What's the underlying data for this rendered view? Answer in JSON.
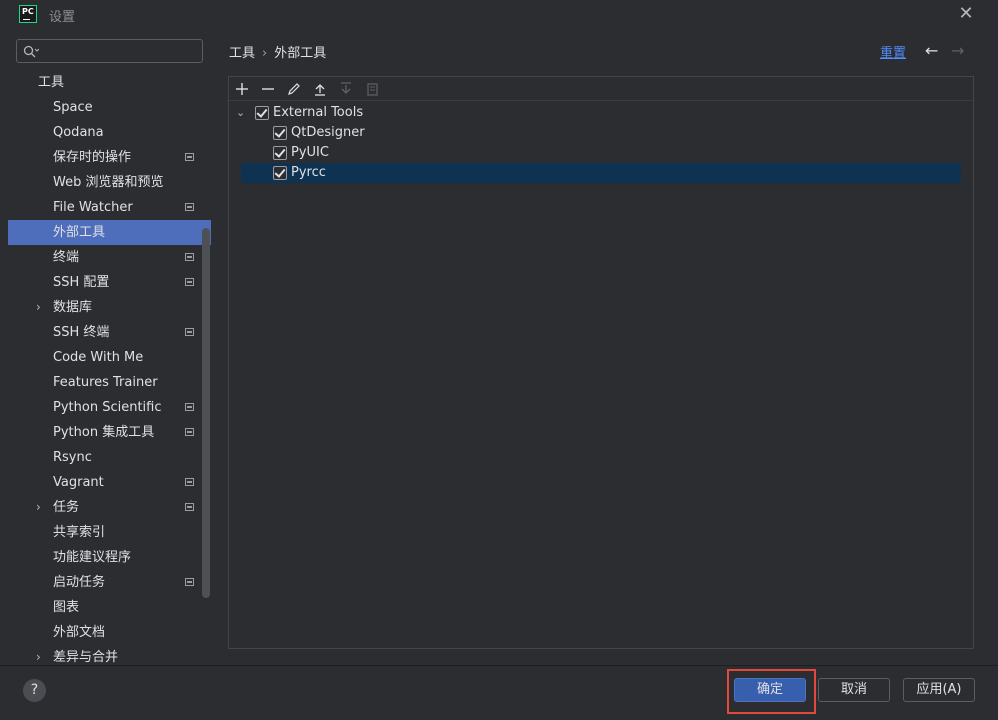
{
  "window": {
    "logo_text": "PC",
    "title": "设置",
    "close_icon": "close-icon"
  },
  "search": {
    "placeholder": "",
    "value": ""
  },
  "sidebar": {
    "items": [
      {
        "label": "工具",
        "type": "group"
      },
      {
        "label": "Space"
      },
      {
        "label": "Qodana"
      },
      {
        "label": "保存时的操作",
        "project": true
      },
      {
        "label": "Web 浏览器和预览"
      },
      {
        "label": "File Watcher",
        "project": true
      },
      {
        "label": "外部工具",
        "selected": true
      },
      {
        "label": "终端",
        "project": true
      },
      {
        "label": "SSH 配置",
        "project": true
      },
      {
        "label": "数据库",
        "expandable": true
      },
      {
        "label": "SSH 终端",
        "project": true
      },
      {
        "label": "Code With Me"
      },
      {
        "label": "Features Trainer"
      },
      {
        "label": "Python Scientific",
        "project": true
      },
      {
        "label": "Python 集成工具",
        "project": true
      },
      {
        "label": "Rsync"
      },
      {
        "label": "Vagrant",
        "project": true
      },
      {
        "label": "任务",
        "expandable": true,
        "project": true
      },
      {
        "label": "共享索引"
      },
      {
        "label": "功能建议程序"
      },
      {
        "label": "启动任务",
        "project": true
      },
      {
        "label": "图表"
      },
      {
        "label": "外部文档"
      },
      {
        "label": "差异与合并",
        "expandable": true
      }
    ]
  },
  "header": {
    "breadcrumb": [
      "工具",
      "外部工具"
    ],
    "breadcrumb_sep": "›",
    "reset_label": "重置"
  },
  "toolbar": {
    "buttons": [
      "add-icon",
      "remove-icon",
      "edit-icon",
      "move-up-icon",
      "move-down-icon",
      "copy-icon"
    ]
  },
  "tree": {
    "group": {
      "label": "External Tools",
      "checked": true,
      "expanded": true
    },
    "children": [
      {
        "label": "QtDesigner",
        "checked": true
      },
      {
        "label": "PyUIC",
        "checked": true
      },
      {
        "label": "Pyrcc",
        "checked": true,
        "selected": true
      }
    ]
  },
  "footer": {
    "help_label": "?",
    "ok_label": "确定",
    "cancel_label": "取消",
    "apply_label": "应用(A)"
  },
  "colors": {
    "background": "#2b2d30",
    "selection_sidebar": "#4e6ebc",
    "selection_tree": "#0e3352",
    "primary_button": "#375fad",
    "link": "#548af7",
    "highlight_box": "#e0493b"
  }
}
